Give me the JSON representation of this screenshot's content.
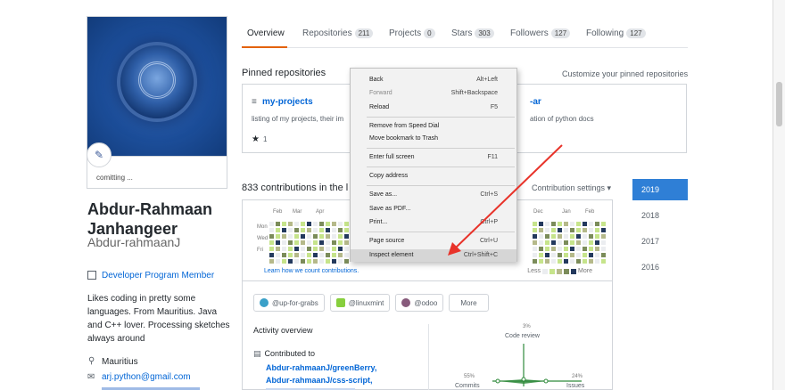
{
  "profile": {
    "fullname_line1": "Abdur-Rahmaan",
    "fullname_line2": "Janhangeer",
    "username": "Abdur-rahmaanJ",
    "status": "comitting ...",
    "program": "Developer Program Member",
    "bio": "Likes coding in pretty some languages. From Mauritius. Java and C++ lover. Processing sketches always around",
    "location": "Mauritius",
    "email": "arj.python@gmail.com"
  },
  "tabs": [
    {
      "label": "Overview",
      "count": ""
    },
    {
      "label": "Repositories",
      "count": "211"
    },
    {
      "label": "Projects",
      "count": "0"
    },
    {
      "label": "Stars",
      "count": "303"
    },
    {
      "label": "Followers",
      "count": "127"
    },
    {
      "label": "Following",
      "count": "127"
    }
  ],
  "pinned": {
    "heading": "Pinned repositories",
    "customize": "Customize your pinned repositories",
    "repo1": {
      "name": "my-projects",
      "desc": "listing of my projects, their im",
      "stars": "1"
    },
    "repo2": {
      "name_tail": "-ar",
      "desc_tail": "ation of python docs"
    }
  },
  "contributions": {
    "heading": "833 contributions in the l",
    "settings": "Contribution settings",
    "months_left": [
      "Feb",
      "Mar",
      "Apr"
    ],
    "months_right": [
      "Dec",
      "Jan",
      "Feb"
    ],
    "days": [
      "Mon",
      "Wed",
      "Fri"
    ],
    "learn": "Learn how we count contributions.",
    "less": "Less",
    "more": "More"
  },
  "years": [
    "2019",
    "2018",
    "2017",
    "2016"
  ],
  "orgs": [
    {
      "name": "@up-for-grabs",
      "color": "#3aa0c8"
    },
    {
      "name": "@linuxmint",
      "color": "#87cf3e"
    },
    {
      "name": "@odoo",
      "color": "#875a7b"
    }
  ],
  "orgs_more": "More",
  "activity": {
    "heading": "Activity overview",
    "contributed": "Contributed to",
    "links": [
      "Abdur-rahmaanJ/greenBerry,",
      "Abdur-rahmaanJ/css-script,"
    ],
    "radar": {
      "code_review": "Code review",
      "code_review_pct": "3%",
      "commits": "Commits",
      "commits_pct": "55%",
      "issues": "Issues",
      "issues_pct": "24%"
    }
  },
  "context_menu": {
    "items": [
      {
        "label": "Back",
        "shortcut": "Alt+Left",
        "disabled": false
      },
      {
        "label": "Forward",
        "shortcut": "Shift+Backspace",
        "disabled": true
      },
      {
        "label": "Reload",
        "shortcut": "F5",
        "disabled": false
      },
      {
        "label": "Remove from Speed Dial",
        "shortcut": "",
        "disabled": false
      },
      {
        "label": "Move bookmark to Trash",
        "shortcut": "",
        "disabled": false
      },
      {
        "label": "Enter full screen",
        "shortcut": "F11",
        "disabled": false
      },
      {
        "label": "Copy address",
        "shortcut": "",
        "disabled": false
      },
      {
        "label": "Save as...",
        "shortcut": "Ctrl+S",
        "disabled": false
      },
      {
        "label": "Save as PDF...",
        "shortcut": "",
        "disabled": false
      },
      {
        "label": "Print...",
        "shortcut": "Ctrl+P",
        "disabled": false
      },
      {
        "label": "Page source",
        "shortcut": "Ctrl+U",
        "disabled": false
      },
      {
        "label": "Inspect element",
        "shortcut": "Ctrl+Shift+C",
        "disabled": false
      }
    ]
  },
  "colors": {
    "accent": "#e36209",
    "link": "#0366d6",
    "year_active": "#2f7fd6",
    "arrow": "#e8332a"
  }
}
